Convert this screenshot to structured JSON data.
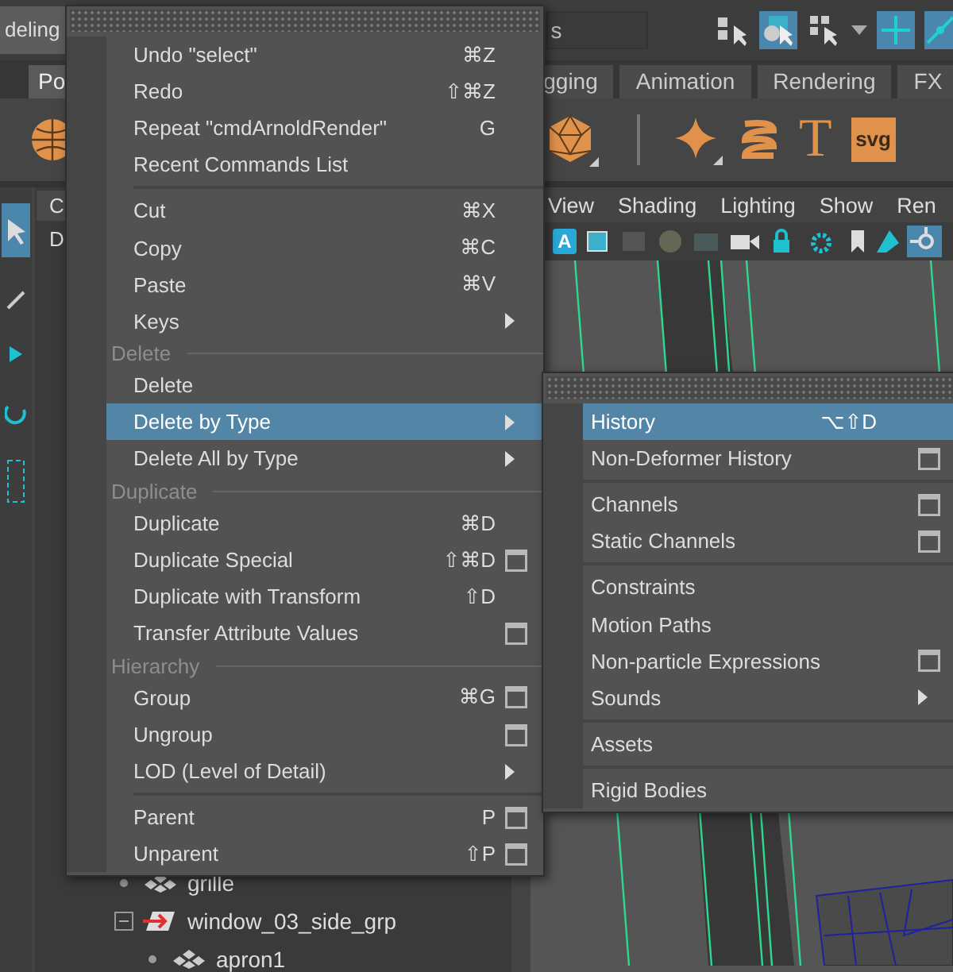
{
  "app": {
    "workspace": "deling",
    "search_text": "s"
  },
  "shelf_tabs": [
    {
      "label": "Po",
      "selected": true
    },
    {
      "label": "gging",
      "selected": false
    },
    {
      "label": "Animation",
      "selected": false
    },
    {
      "label": "Rendering",
      "selected": false
    },
    {
      "label": "FX",
      "selected": false
    }
  ],
  "shelf": {
    "text_icon_text": "T",
    "svg_icon_text": "svg"
  },
  "outliner": {
    "tabs": [
      "C",
      "D"
    ],
    "tree": [
      {
        "label": "grille",
        "kind": "mesh"
      },
      {
        "label": "window_03_side_grp",
        "kind": "group",
        "expanded": true,
        "children": [
          {
            "label": "apron1",
            "kind": "mesh"
          }
        ]
      }
    ]
  },
  "viewport": {
    "menus": [
      "View",
      "Shading",
      "Lighting",
      "Show",
      "Ren"
    ],
    "icon_text": "A"
  },
  "edit_menu": {
    "items": [
      {
        "kind": "item",
        "label": "Undo \"select\"",
        "shortcut": "⌘Z",
        "selected": false
      },
      {
        "kind": "item",
        "label": "Redo",
        "shortcut": "⇧⌘Z",
        "selected": false
      },
      {
        "kind": "item",
        "label": "Repeat \"cmdArnoldRender\"",
        "shortcut": "G",
        "selected": false
      },
      {
        "kind": "item",
        "label": "Recent Commands List",
        "selected": false
      },
      {
        "kind": "separator"
      },
      {
        "kind": "item",
        "label": "Cut",
        "shortcut": "⌘X",
        "selected": false
      },
      {
        "kind": "item",
        "label": "Copy",
        "shortcut": "⌘C",
        "selected": false
      },
      {
        "kind": "item",
        "label": "Paste",
        "shortcut": "⌘V",
        "selected": false
      },
      {
        "kind": "item",
        "label": "Keys",
        "submenu": true,
        "selected": false
      },
      {
        "kind": "section",
        "label": "Delete"
      },
      {
        "kind": "item",
        "label": "Delete",
        "selected": false
      },
      {
        "kind": "item",
        "label": "Delete by Type",
        "submenu": true,
        "selected": true
      },
      {
        "kind": "item",
        "label": "Delete All by Type",
        "submenu": true,
        "selected": false
      },
      {
        "kind": "section",
        "label": "Duplicate"
      },
      {
        "kind": "item",
        "label": "Duplicate",
        "shortcut": "⌘D",
        "selected": false
      },
      {
        "kind": "item",
        "label": "Duplicate Special",
        "shortcut": "⇧⌘D",
        "option_box": true,
        "selected": false
      },
      {
        "kind": "item",
        "label": "Duplicate with Transform",
        "shortcut": "⇧D",
        "selected": false
      },
      {
        "kind": "item",
        "label": "Transfer Attribute Values",
        "option_box": true,
        "selected": false
      },
      {
        "kind": "section",
        "label": "Hierarchy"
      },
      {
        "kind": "item",
        "label": "Group",
        "shortcut": "⌘G",
        "option_box": true,
        "selected": false
      },
      {
        "kind": "item",
        "label": "Ungroup",
        "option_box": true,
        "selected": false
      },
      {
        "kind": "item",
        "label": "LOD (Level of Detail)",
        "submenu": true,
        "selected": false
      },
      {
        "kind": "separator"
      },
      {
        "kind": "item",
        "label": "Parent",
        "shortcut": "P",
        "option_box": true,
        "selected": false
      },
      {
        "kind": "item",
        "label": "Unparent",
        "shortcut": "⇧P",
        "option_box": true,
        "selected": false
      }
    ]
  },
  "submenu": {
    "items": [
      {
        "kind": "item",
        "label": "History",
        "shortcut": "⌥⇧D",
        "selected": true
      },
      {
        "kind": "item",
        "label": "Non-Deformer History",
        "option_box": true,
        "selected": false
      },
      {
        "kind": "separator"
      },
      {
        "kind": "item",
        "label": "Channels",
        "option_box": true,
        "selected": false
      },
      {
        "kind": "item",
        "label": "Static Channels",
        "option_box": true,
        "selected": false
      },
      {
        "kind": "separator"
      },
      {
        "kind": "item",
        "label": "Constraints",
        "selected": false
      },
      {
        "kind": "item",
        "label": "Motion Paths",
        "selected": false
      },
      {
        "kind": "item",
        "label": "Non-particle Expressions",
        "option_box": true,
        "selected": false
      },
      {
        "kind": "item",
        "label": "Sounds",
        "submenu": true,
        "selected": false
      },
      {
        "kind": "separator"
      },
      {
        "kind": "item",
        "label": "Assets",
        "selected": false
      },
      {
        "kind": "separator"
      },
      {
        "kind": "item",
        "label": "Rigid Bodies",
        "selected": false
      }
    ]
  }
}
